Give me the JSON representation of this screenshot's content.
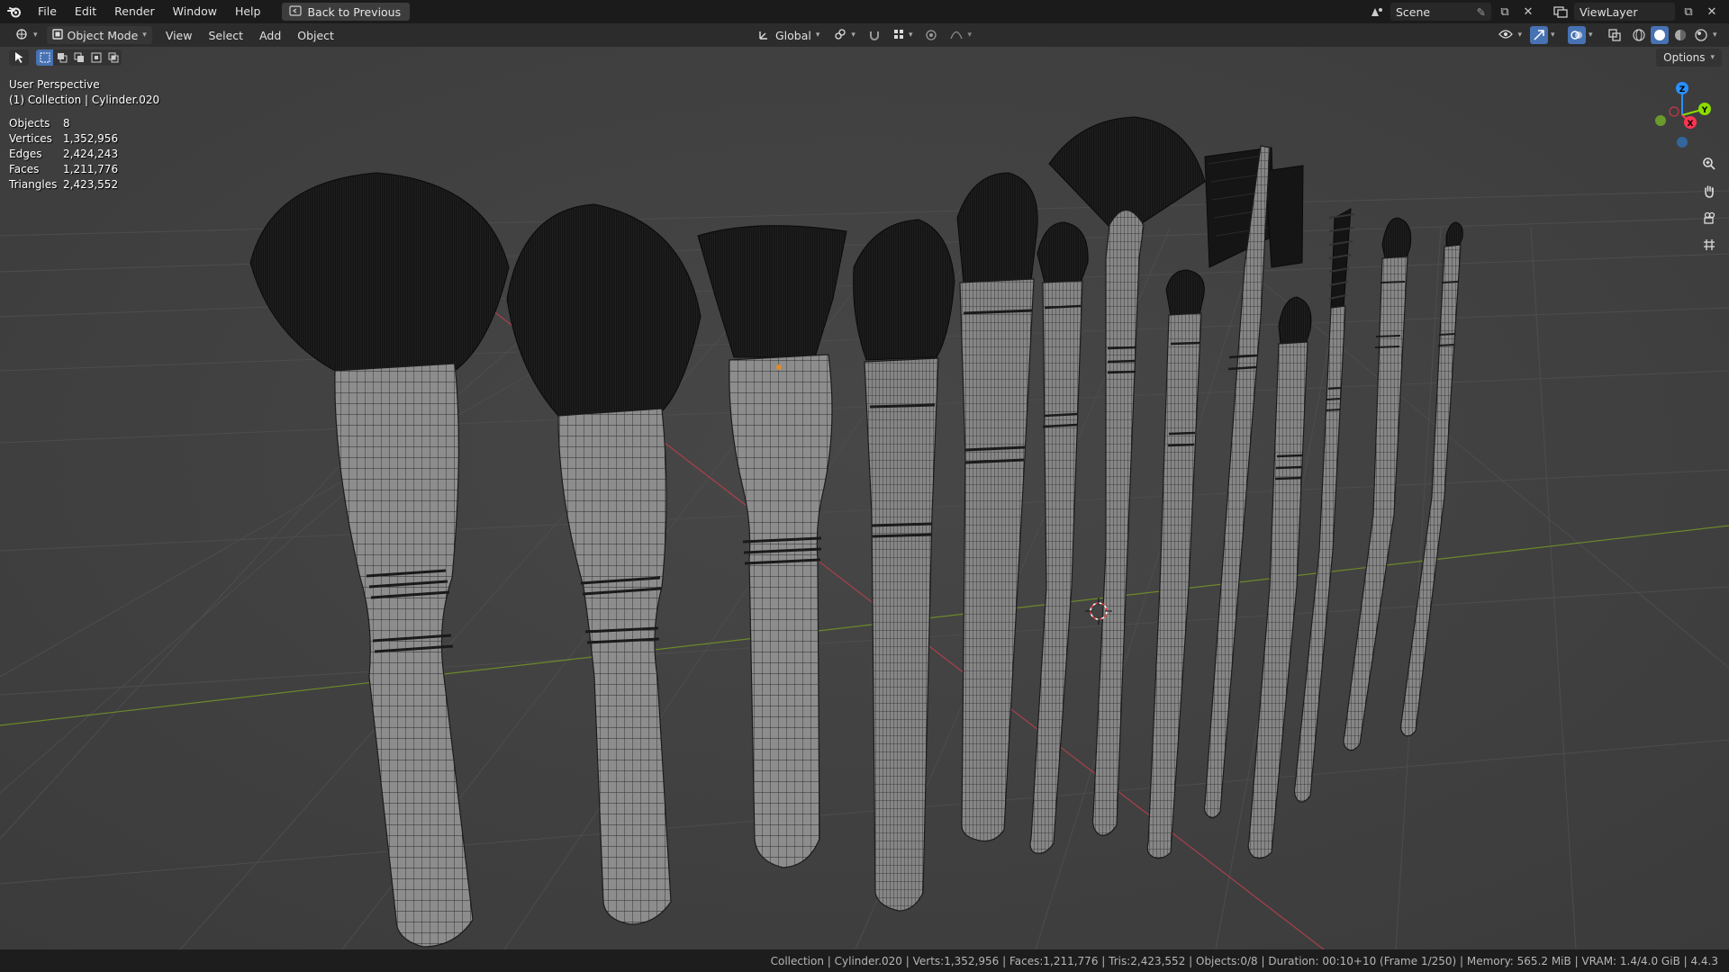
{
  "menubar": {
    "items": [
      "File",
      "Edit",
      "Render",
      "Window",
      "Help"
    ],
    "back_button": "Back to Previous",
    "scene": "Scene",
    "view_layer": "ViewLayer"
  },
  "viewport_header": {
    "mode": "Object Mode",
    "menus": [
      "View",
      "Select",
      "Add",
      "Object"
    ],
    "orientation": "Global",
    "options_label": "Options"
  },
  "overlay": {
    "view_name": "User Perspective",
    "active": "(1) Collection | Cylinder.020",
    "stats": [
      {
        "label": "Objects",
        "value": "8"
      },
      {
        "label": "Vertices",
        "value": "1,352,956"
      },
      {
        "label": "Edges",
        "value": "2,424,243"
      },
      {
        "label": "Faces",
        "value": "1,211,776"
      },
      {
        "label": "Triangles",
        "value": "2,423,552"
      }
    ]
  },
  "gizmo": {
    "z": "Z",
    "y": "Y",
    "x": "X"
  },
  "statusbar": {
    "text": "Collection | Cylinder.020 | Verts:1,352,956 | Faces:1,211,776 | Tris:2,423,552 | Objects:0/8 | Duration: 00:10+10 (Frame 1/250) | Memory: 565.2 MiB | VRAM: 1.4/4.0 GiB | 4.4.3"
  },
  "colors": {
    "accent": "#4772b3",
    "x_axis": "#ff3352",
    "y_axis": "#8bdc00",
    "z_axis": "#2890ff"
  }
}
